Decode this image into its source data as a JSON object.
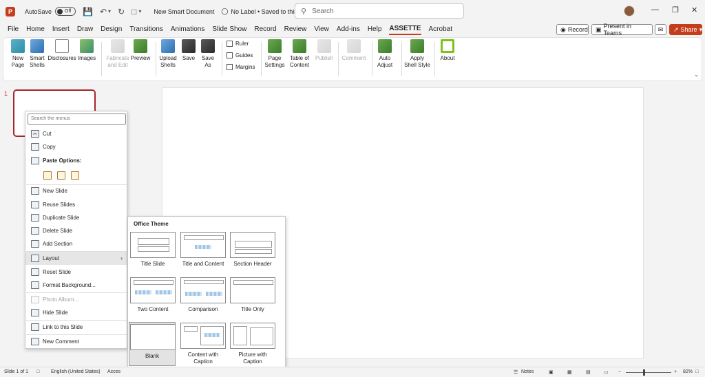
{
  "titlebar": {
    "autosave_label": "AutoSave",
    "toggle_state": "Off",
    "doc_title": "New Smart Document",
    "label_info": "No Label • Saved to this PC",
    "search_placeholder": "Search"
  },
  "tabs": [
    "File",
    "Home",
    "Insert",
    "Draw",
    "Design",
    "Transitions",
    "Animations",
    "Slide Show",
    "Record",
    "Review",
    "View",
    "Add-ins",
    "Help",
    "ASSETTE",
    "Acrobat"
  ],
  "active_tab": "ASSETTE",
  "header_buttons": {
    "record": "Record",
    "present": "Present in Teams",
    "share": "Share"
  },
  "ribbon": {
    "new_page": "New Page",
    "smart_shells": "Smart Shells",
    "disclosures": "Disclosures",
    "images": "Images",
    "fabricate": "Fabricate and Edit",
    "preview": "Preview",
    "upload_shells": "Upload Shells",
    "save": "Save",
    "save_as": "Save As",
    "ruler": "Ruler",
    "guides": "Guides",
    "margins": "Margins",
    "page_settings": "Page Settings",
    "table_of_content": "Table of Content",
    "publish": "Publish",
    "comment": "Comment",
    "auto_adjust": "Auto Adjust",
    "apply_shell_style": "Apply Shell Style",
    "about": "About"
  },
  "slide_pane": {
    "slide_number": "1"
  },
  "context_menu": {
    "search_placeholder": "Search the menus",
    "cut": "Cut",
    "copy": "Copy",
    "paste_options": "Paste Options:",
    "new_slide": "New Slide",
    "reuse_slides": "Reuse Slides",
    "duplicate_slide": "Duplicate Slide",
    "delete_slide": "Delete Slide",
    "add_section": "Add Section",
    "layout": "Layout",
    "reset_slide": "Reset Slide",
    "format_background": "Format Background...",
    "photo_album": "Photo Album...",
    "hide_slide": "Hide Slide",
    "link_to_slide": "Link to this Slide",
    "new_comment": "New Comment"
  },
  "layout_flyout": {
    "title": "Office Theme",
    "layouts": [
      "Title Slide",
      "Title and Content",
      "Section Header",
      "Two Content",
      "Comparison",
      "Title Only",
      "Blank",
      "Content with Caption",
      "Picture with Caption"
    ],
    "selected": "Blank"
  },
  "status": {
    "slide_of": "Slide 1 of 1",
    "language": "English (United States)",
    "accessibility": "Acces",
    "notes": "Notes",
    "zoom": "82%"
  },
  "colors": {
    "accent": "#c43e1c",
    "selected_border": "#a4262c"
  }
}
